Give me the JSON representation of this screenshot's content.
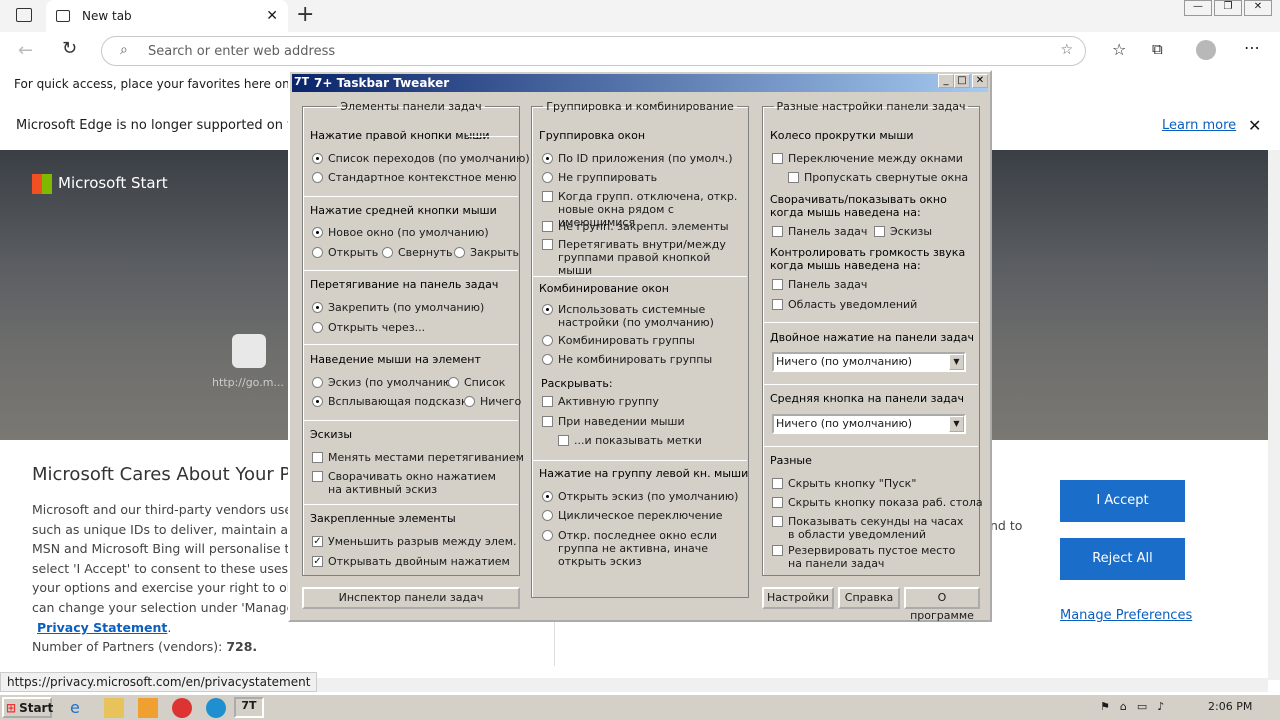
{
  "browser": {
    "tab_title": "New tab",
    "omnibox_placeholder": "Search or enter web address",
    "fav_hint": "For quick access, place your favorites here on the fav",
    "notice": "Microsoft Edge is no longer supported on this",
    "learn_more": "Learn more",
    "status_url": "https://privacy.microsoft.com/en/privacystatement"
  },
  "page": {
    "brand": "Microsoft Start",
    "tile_label": "http://go.m...",
    "cookie_title": "Microsoft Cares About Your Pr",
    "cookie_lines": [
      "Microsoft and our third-party vendors use c",
      "such as unique IDs to deliver, maintain and i",
      "MSN and Microsoft Bing will personalise the",
      "select 'I Accept' to consent to these uses or",
      "your options and exercise your right to obje",
      "can change your selection under 'Manage P"
    ],
    "privacy_link": "Privacy Statement",
    "partners_label": "Number of Partners (vendors):",
    "partners_count": "728.",
    "and_to": "nd to",
    "accept": "I Accept",
    "reject": "Reject All",
    "manage": "Manage Preferences"
  },
  "taskbar": {
    "start": "Start",
    "time": "2:06 PM"
  },
  "dialog": {
    "title": "7+ Taskbar Tweaker",
    "col1": {
      "legend": "Элементы панели задач",
      "g1": "Нажатие правой кнопки мыши",
      "g1a": "Список переходов (по умолчанию)",
      "g1b": "Стандартное контекстное меню",
      "g2": "Нажатие средней кнопки мыши",
      "g2a": "Новое окно (по умолчанию)",
      "g2b": "Открыть",
      "g2c": "Свернуть",
      "g2d": "Закрыть",
      "g3": "Перетягивание на панель задач",
      "g3a": "Закрепить (по умолчанию)",
      "g3b": "Открыть через...",
      "g4": "Наведение мыши на элемент",
      "g4a": "Эскиз (по умолчанию)",
      "g4b": "Список",
      "g4c": "Всплывающая подсказка",
      "g4d": "Ничего",
      "g5": "Эскизы",
      "g5a": "Менять местами перетягиванием",
      "g5b": "Сворачивать окно нажатием на активный эскиз",
      "g6": "Закрепленные элементы",
      "g6a": "Уменьшить разрыв между элем.",
      "g6b": "Открывать двойным нажатием",
      "btn": "Инспектор панели задач"
    },
    "col2": {
      "legend": "Группировка и комбинирование",
      "g1": "Группировка окон",
      "g1a": "По ID приложения (по умолч.)",
      "g1b": "Не группировать",
      "g1c": "Когда групп. отключена, откр. новые окна рядом с имеющимися",
      "g1d": "Не групп. закрепл. элементы",
      "g1e": "Перетягивать внутри/между группами правой кнопкой мыши",
      "g2": "Комбинирование окон",
      "g2a": "Использовать системные настройки (по умолчанию)",
      "g2b": "Комбинировать группы",
      "g2c": "Не комбинировать группы",
      "g2d": "Раскрывать:",
      "g2e": "Активную группу",
      "g2f": "При наведении мыши",
      "g2g": "...и показывать метки",
      "g3": "Нажатие на группу левой кн. мыши",
      "g3a": "Открыть эскиз (по умолчанию)",
      "g3b": "Циклическое переключение",
      "g3c": "Откр. последнее окно если группа не активна, иначе открыть эскиз"
    },
    "col3": {
      "legend": "Разные настройки панели задач",
      "g1": "Колесо прокрутки мыши",
      "g1a": "Переключение между окнами",
      "g1b": "Пропускать свернутые окна",
      "g1c": "Сворачивать/показывать окно когда мышь наведена на:",
      "g1d": "Панель задач",
      "g1e": "Эскизы",
      "g1f": "Контролировать громкость звука когда мышь наведена на:",
      "g1g": "Панель задач",
      "g1h": "Область уведомлений",
      "g2": "Двойное нажатие на панели задач",
      "g2v": "Ничего (по умолчанию)",
      "g3": "Средняя кнопка на панели задач",
      "g3v": "Ничего (по умолчанию)",
      "g4": "Разные",
      "g4a": "Скрыть кнопку \"Пуск\"",
      "g4b": "Скрыть кнопку показа раб. стола",
      "g4c": "Показывать секунды на часах в области уведомлений",
      "g4d": "Резервировать пустое место на панели задач",
      "btn_settings": "Настройки",
      "btn_help": "Справка",
      "btn_about": "О программе"
    }
  }
}
